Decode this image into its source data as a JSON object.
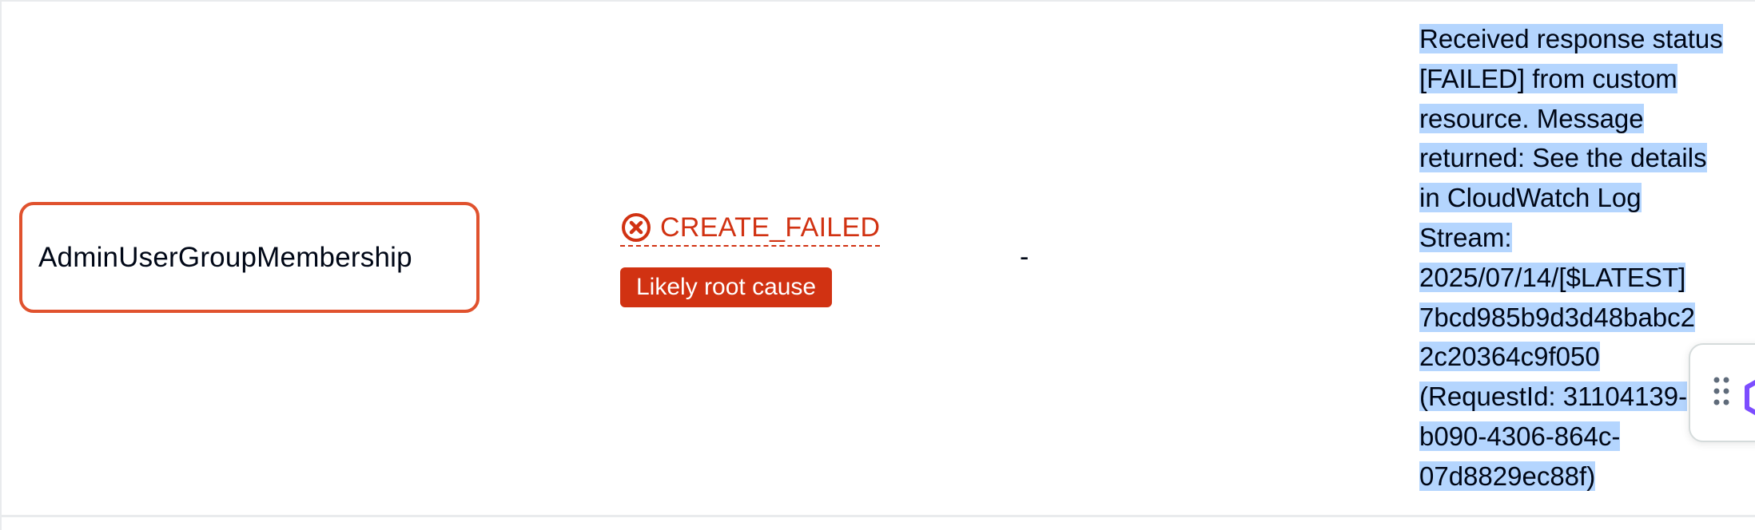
{
  "resource": {
    "logical_id": "AdminUserGroupMembership",
    "status": "CREATE_FAILED",
    "root_cause_badge": "Likely root cause",
    "physical_id": "-",
    "status_reason_lines": [
      "Received response status",
      "[FAILED] from custom",
      "resource. Message",
      "returned: See the details",
      "in CloudWatch Log",
      "Stream:",
      "2025/07/14/[$LATEST]",
      "7bcd985b9d3d48babc2",
      "2c20364c9f050",
      "(RequestId: 31104139-",
      "b090-4306-864c-",
      "07d8829ec88f)"
    ]
  },
  "colors": {
    "error": "#d13212",
    "highlight_border": "#e0522e",
    "selection": "#b4d5fe",
    "widget_accent": "#7c4dff"
  },
  "icons": {
    "status": "error-circle-icon",
    "drag": "drag-handle-icon",
    "widget": "hexagon-logo-icon"
  }
}
